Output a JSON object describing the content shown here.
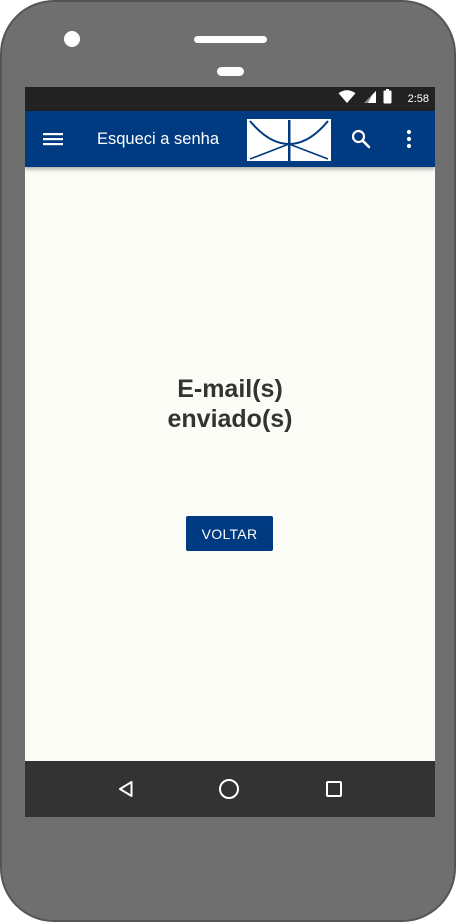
{
  "status_bar": {
    "time": "2:58",
    "icons": [
      "wifi-icon",
      "cellular-signal-icon",
      "battery-icon"
    ]
  },
  "app_bar": {
    "title": "Esqueci a senha",
    "icons": [
      "menu-icon",
      "logo",
      "search-icon",
      "more-vert-icon"
    ],
    "color": "#003a80"
  },
  "main": {
    "message_line1": "E-mail(s)",
    "message_line2": "enviado(s)",
    "back_button_label": "VOLTAR"
  },
  "nav_bar": {
    "icons": [
      "back-icon",
      "home-icon",
      "recents-icon"
    ]
  },
  "colors": {
    "primary": "#003a80",
    "screen_background": "#fcfcf6",
    "message_text": "#333333",
    "device_body": "#6f6f6f"
  }
}
